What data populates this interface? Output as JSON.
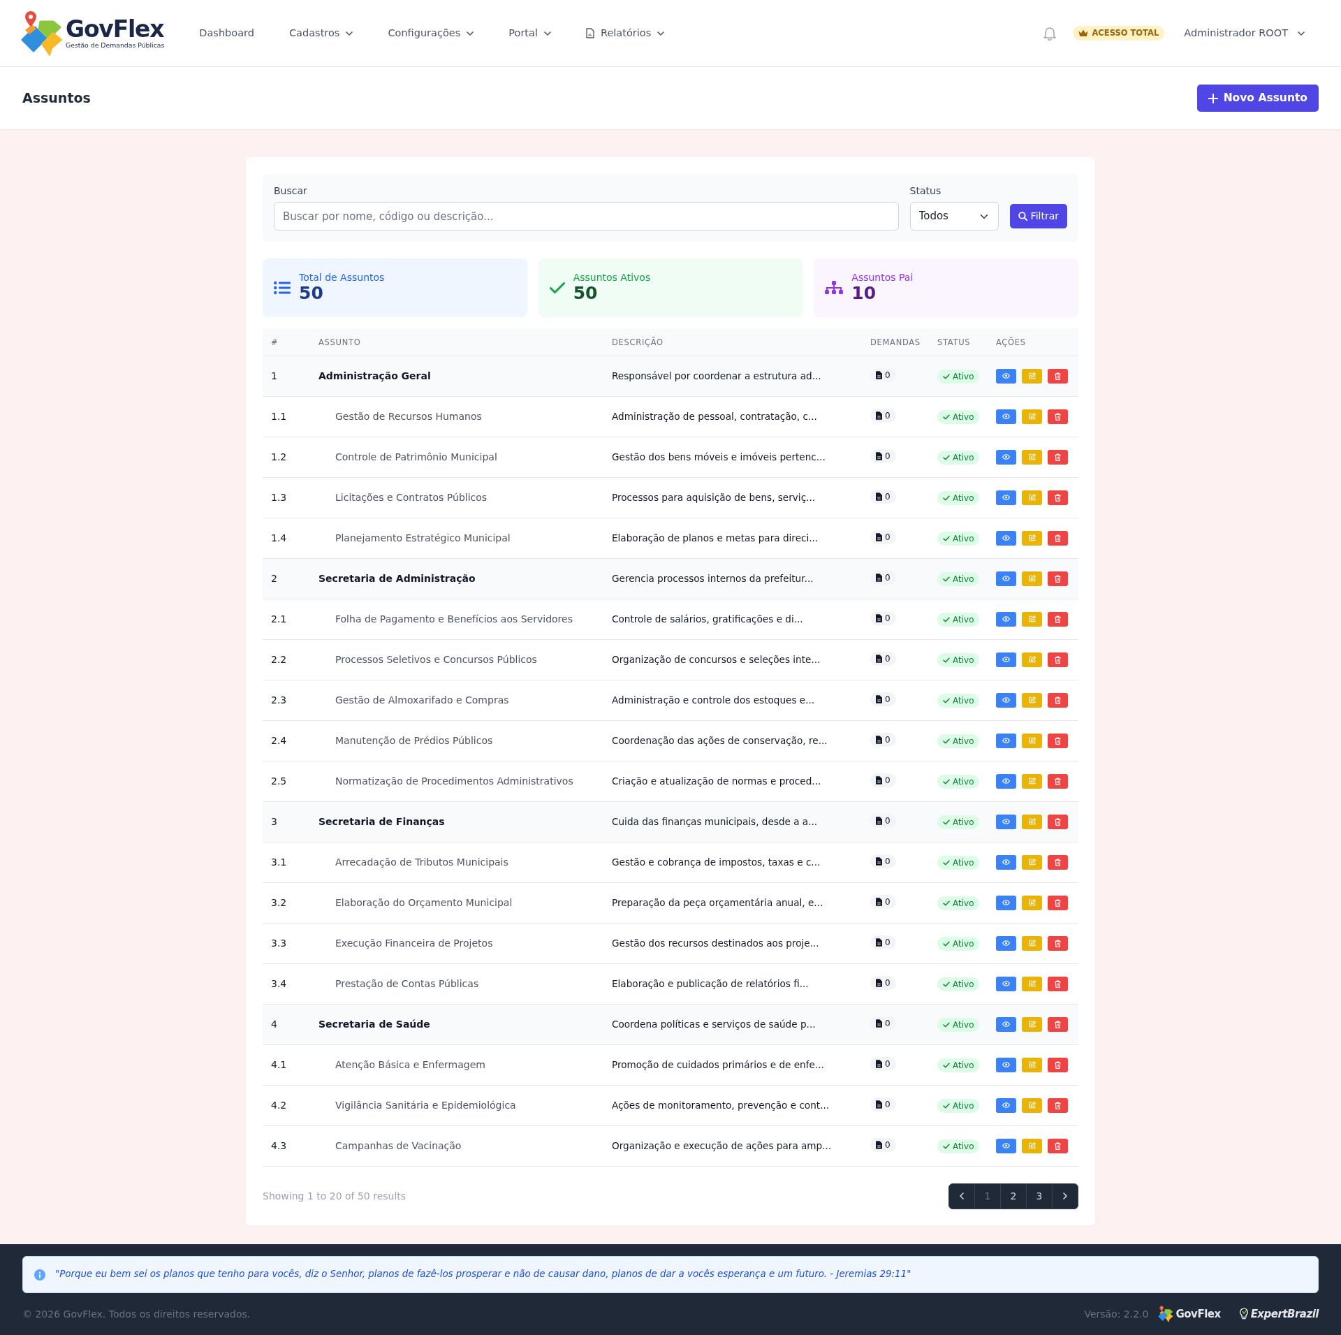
{
  "navbar": {
    "brand": {
      "name": "GovFlex",
      "tagline": "Gestão de Demandas Públicas"
    },
    "menu": [
      {
        "label": "Dashboard",
        "dropdown": false,
        "icon": false
      },
      {
        "label": "Cadastros",
        "dropdown": true,
        "icon": false
      },
      {
        "label": "Configurações",
        "dropdown": true,
        "icon": false
      },
      {
        "label": "Portal",
        "dropdown": true,
        "icon": false
      },
      {
        "label": "Relatórios",
        "dropdown": true,
        "icon": true
      }
    ],
    "access_badge": "ACESSO TOTAL",
    "user": "Administrador ROOT"
  },
  "page_header": {
    "title": "Assuntos",
    "action": "Novo Assunto"
  },
  "filters": {
    "search": {
      "label": "Buscar",
      "placeholder": "Buscar por nome, código ou descrição..."
    },
    "status": {
      "label": "Status",
      "value": "Todos"
    },
    "submit": "Filtrar"
  },
  "stats": [
    {
      "kind": "total",
      "label": "Total de Assuntos",
      "value": "50"
    },
    {
      "kind": "active",
      "label": "Assuntos Ativos",
      "value": "50"
    },
    {
      "kind": "parent",
      "label": "Assuntos Pai",
      "value": "10"
    }
  ],
  "table": {
    "columns": [
      "#",
      "ASSUNTO",
      "DESCRIÇÃO",
      "DEMANDAS",
      "STATUS",
      "AÇÕES"
    ],
    "rows": [
      {
        "code": "1",
        "name": "Administração Geral",
        "description": "Responsável por coordenar a estrutura ad...",
        "demands": "0",
        "status": "Ativo",
        "children": [
          {
            "code": "1.1",
            "name": "Gestão de Recursos Humanos",
            "description": "Administração de pessoal, contratação, c...",
            "demands": "0",
            "status": "Ativo"
          },
          {
            "code": "1.2",
            "name": "Controle de Patrimônio Municipal",
            "description": "Gestão dos bens móveis e imóveis pertenc...",
            "demands": "0",
            "status": "Ativo"
          },
          {
            "code": "1.3",
            "name": "Licitações e Contratos Públicos",
            "description": "Processos para aquisição de bens, serviç...",
            "demands": "0",
            "status": "Ativo"
          },
          {
            "code": "1.4",
            "name": "Planejamento Estratégico Municipal",
            "description": "Elaboração de planos e metas para direci...",
            "demands": "0",
            "status": "Ativo"
          }
        ]
      },
      {
        "code": "2",
        "name": "Secretaria de Administração",
        "description": "Gerencia processos internos da prefeitur...",
        "demands": "0",
        "status": "Ativo",
        "children": [
          {
            "code": "2.1",
            "name": "Folha de Pagamento e Benefícios aos Servidores",
            "description": "Controle de salários, gratificações e di...",
            "demands": "0",
            "status": "Ativo"
          },
          {
            "code": "2.2",
            "name": "Processos Seletivos e Concursos Públicos",
            "description": "Organização de concursos e seleções inte...",
            "demands": "0",
            "status": "Ativo"
          },
          {
            "code": "2.3",
            "name": "Gestão de Almoxarifado e Compras",
            "description": "Administração e controle dos estoques e...",
            "demands": "0",
            "status": "Ativo"
          },
          {
            "code": "2.4",
            "name": "Manutenção de Prédios Públicos",
            "description": "Coordenação das ações de conservação, re...",
            "demands": "0",
            "status": "Ativo"
          },
          {
            "code": "2.5",
            "name": "Normatização de Procedimentos Administrativos",
            "description": "Criação e atualização de normas e proced...",
            "demands": "0",
            "status": "Ativo"
          }
        ]
      },
      {
        "code": "3",
        "name": "Secretaria de Finanças",
        "description": "Cuida das finanças municipais, desde a a...",
        "demands": "0",
        "status": "Ativo",
        "children": [
          {
            "code": "3.1",
            "name": "Arrecadação de Tributos Municipais",
            "description": "Gestão e cobrança de impostos, taxas e c...",
            "demands": "0",
            "status": "Ativo"
          },
          {
            "code": "3.2",
            "name": "Elaboração do Orçamento Municipal",
            "description": "Preparação da peça orçamentária anual, e...",
            "demands": "0",
            "status": "Ativo"
          },
          {
            "code": "3.3",
            "name": "Execução Financeira de Projetos",
            "description": "Gestão dos recursos destinados aos proje...",
            "demands": "0",
            "status": "Ativo"
          },
          {
            "code": "3.4",
            "name": "Prestação de Contas Públicas",
            "description": "Elaboração e publicação de relatórios fi...",
            "demands": "0",
            "status": "Ativo"
          }
        ]
      },
      {
        "code": "4",
        "name": "Secretaria de Saúde",
        "description": "Coordena políticas e serviços de saúde p...",
        "demands": "0",
        "status": "Ativo",
        "children": [
          {
            "code": "4.1",
            "name": "Atenção Básica e Enfermagem",
            "description": "Promoção de cuidados primários e de enfe...",
            "demands": "0",
            "status": "Ativo"
          },
          {
            "code": "4.2",
            "name": "Vigilância Sanitária e Epidemiológica",
            "description": "Ações de monitoramento, prevenção e cont...",
            "demands": "0",
            "status": "Ativo"
          },
          {
            "code": "4.3",
            "name": "Campanhas de Vacinação",
            "description": "Organização e execução de ações para amp...",
            "demands": "0",
            "status": "Ativo"
          }
        ]
      }
    ]
  },
  "pagination": {
    "summary": "Showing 1 to 20 of 50 results",
    "pages": [
      {
        "label": "1",
        "selected": true
      },
      {
        "label": "2",
        "selected": false
      },
      {
        "label": "3",
        "selected": false
      }
    ]
  },
  "footer": {
    "verse": "\"Porque eu bem sei os planos que tenho para vocês, diz o Senhor, planos de fazê-los prosperar e não de causar dano, planos de dar a vocês esperança e um futuro. - Jeremias 29:11\"",
    "copyright": "© 2026 GovFlex. Todos os direitos reservados.",
    "version": "Versão: 2.2.0",
    "brands": [
      {
        "kind": "govflex",
        "name": "GovFlex"
      },
      {
        "kind": "expert",
        "name": "ExpertBrazil"
      }
    ]
  }
}
